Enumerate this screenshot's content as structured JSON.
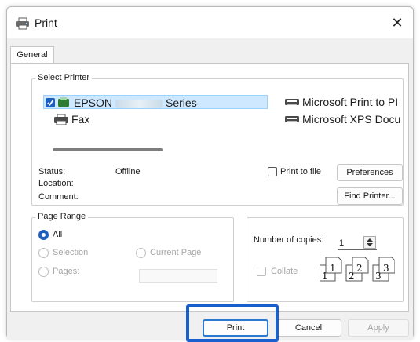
{
  "window": {
    "title": "Print",
    "close_icon": "close-icon"
  },
  "tabs": [
    {
      "label": "General"
    }
  ],
  "select_printer": {
    "group_label": "Select Printer",
    "printers": [
      {
        "label_pre": "EPSON",
        "label_post": "Series",
        "selected": true,
        "icon": "printer-check-icon"
      },
      {
        "label": "Fax",
        "icon": "fax-icon"
      },
      {
        "label": "Microsoft Print to PI",
        "icon": "printer-icon"
      },
      {
        "label": "Microsoft XPS Docu",
        "icon": "printer-icon"
      }
    ],
    "status_label": "Status:",
    "status_value": "Offline",
    "location_label": "Location:",
    "comment_label": "Comment:",
    "print_to_file_label": "Print to file",
    "preferences_label": "Preferences",
    "find_printer_label": "Find Printer..."
  },
  "page_range": {
    "group_label": "Page Range",
    "all_label": "All",
    "selection_label": "Selection",
    "current_page_label": "Current Page",
    "pages_label": "Pages:"
  },
  "copies": {
    "number_label": "Number of copies:",
    "number_value": "1",
    "collate_label": "Collate",
    "collate_pages": [
      "1",
      "1",
      "2",
      "2",
      "3",
      "3"
    ]
  },
  "footer": {
    "print_label": "Print",
    "cancel_label": "Cancel",
    "apply_label": "Apply"
  },
  "colors": {
    "accent": "#1a5fd0",
    "selection_bg": "#cde8ff"
  }
}
